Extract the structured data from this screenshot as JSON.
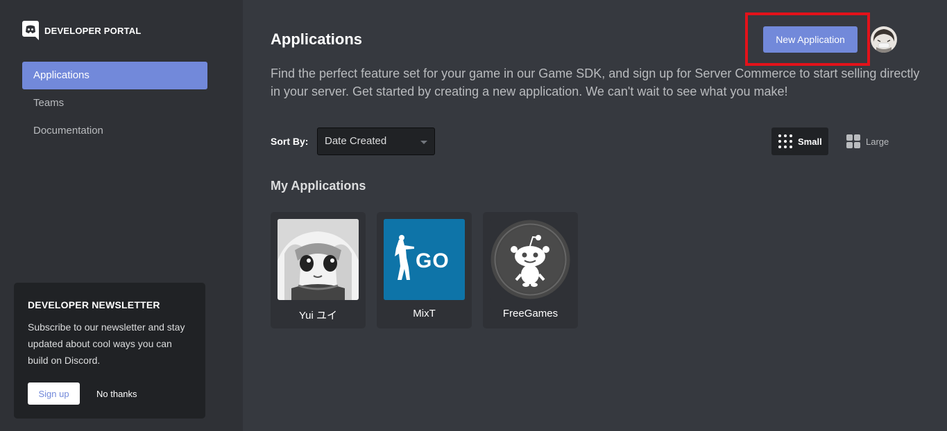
{
  "brand": {
    "name": "DEVELOPER PORTAL",
    "icon": "discord-logo-icon"
  },
  "sidebar": {
    "items": [
      {
        "label": "Applications",
        "active": true
      },
      {
        "label": "Teams",
        "active": false
      },
      {
        "label": "Documentation",
        "active": false
      }
    ]
  },
  "newsletter": {
    "title": "DEVELOPER NEWSLETTER",
    "body": "Subscribe to our newsletter and stay updated about cool ways you can build on Discord.",
    "signup_label": "Sign up",
    "nothanks_label": "No thanks"
  },
  "header": {
    "title": "Applications",
    "new_app_label": "New Application",
    "avatar_icon": "user-avatar"
  },
  "description": "Find the perfect feature set for your game in our Game SDK, and sign up for Server Commerce to start selling directly in your server. Get started by creating a new application. We can't wait to see what you make!",
  "sort": {
    "label": "Sort By:",
    "selected": "Date Created"
  },
  "view": {
    "small_label": "Small",
    "large_label": "Large",
    "selected": "Small"
  },
  "section_title": "My Applications",
  "apps": [
    {
      "name": "Yui ユイ",
      "icon": "anime-portrait-icon"
    },
    {
      "name": "MixT",
      "icon": "csgo-logo-icon",
      "icon_text": "GO"
    },
    {
      "name": "FreeGames",
      "icon": "reddit-alien-icon"
    }
  ],
  "colors": {
    "accent": "#7289da",
    "highlight": "#e3121a",
    "background": "#36393f",
    "sidebar": "#2f3136",
    "card_dark": "#202225",
    "csgo_blue": "#0e74a8"
  }
}
